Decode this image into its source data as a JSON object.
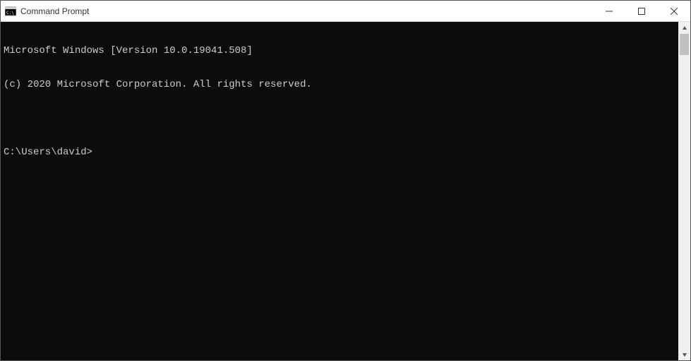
{
  "titlebar": {
    "title": "Command Prompt"
  },
  "console": {
    "line1": "Microsoft Windows [Version 10.0.19041.508]",
    "line2": "(c) 2020 Microsoft Corporation. All rights reserved.",
    "blank": "",
    "prompt": "C:\\Users\\david>"
  }
}
